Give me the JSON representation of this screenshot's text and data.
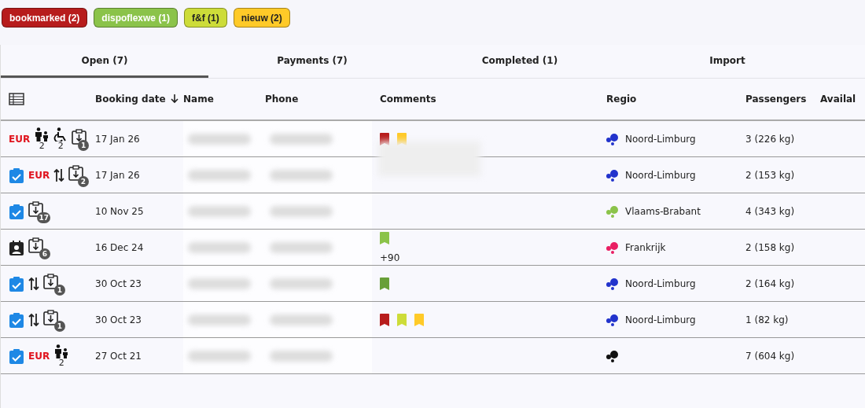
{
  "filters": [
    {
      "label": "bookmarked (2)",
      "color": "#b71c1c"
    },
    {
      "label": "dispoflexwe (1)",
      "color": "#8bc34a"
    },
    {
      "label": "f&f (1)",
      "color": "#cddc39"
    },
    {
      "label": "nieuw (2)",
      "color": "#ffca28"
    }
  ],
  "tabs": [
    {
      "label": "Open (7)",
      "selected": true
    },
    {
      "label": "Payments (7)",
      "selected": false
    },
    {
      "label": "Completed (1)",
      "selected": false
    },
    {
      "label": "Import",
      "selected": false
    }
  ],
  "table": {
    "columns": [
      {
        "label": "Booking date",
        "sorted_descending": true
      },
      {
        "label": "Name"
      },
      {
        "label": "Phone"
      },
      {
        "label": "Comments"
      },
      {
        "label": "Regio"
      },
      {
        "label": "Passengers"
      },
      {
        "label": "Availal"
      }
    ],
    "rows": [
      {
        "flags": [
          {
            "kind": "eur",
            "text": "EUR"
          },
          {
            "kind": "family",
            "count": "2"
          },
          {
            "kind": "wheelchair",
            "count": "2"
          },
          {
            "kind": "clipboard",
            "count": "1"
          }
        ],
        "date": "17 Jan 26",
        "comments": [
          {
            "kind": "bookmark",
            "color": "#b71c1c"
          },
          {
            "kind": "bookmark",
            "color": "#ffca28"
          }
        ],
        "comment_blurred": true,
        "regio": {
          "name": "Noord-Limburg",
          "color": "#2233cc"
        },
        "passengers": "3 (226 kg)"
      },
      {
        "flags": [
          {
            "kind": "check"
          },
          {
            "kind": "eur",
            "text": "EUR"
          },
          {
            "kind": "arrows"
          },
          {
            "kind": "clipboard",
            "count": "2"
          }
        ],
        "date": "17 Jan 26",
        "comments": [],
        "regio": {
          "name": "Noord-Limburg",
          "color": "#2233cc"
        },
        "passengers": "2 (153 kg)"
      },
      {
        "flags": [
          {
            "kind": "check"
          },
          {
            "kind": "clipboard",
            "count": "17"
          }
        ],
        "date": "10 Nov 25",
        "comments": [],
        "regio": {
          "name": "Vlaams-Brabant",
          "color": "#8bc34a"
        },
        "passengers": "4 (343 kg)"
      },
      {
        "flags": [
          {
            "kind": "contact"
          },
          {
            "kind": "clipboard",
            "count": "6"
          }
        ],
        "date": "16 Dec 24",
        "comments": [
          {
            "kind": "bookmark",
            "color": "#8bc34a"
          },
          {
            "kind": "more",
            "text": "+90"
          }
        ],
        "regio": {
          "name": "Frankrijk",
          "color": "#e91e63"
        },
        "passengers": "2 (158 kg)"
      },
      {
        "flags": [
          {
            "kind": "check"
          },
          {
            "kind": "arrows"
          },
          {
            "kind": "clipboard",
            "count": "1"
          }
        ],
        "date": "30 Oct 23",
        "comments": [
          {
            "kind": "bookmark",
            "color": "#689f38"
          }
        ],
        "regio": {
          "name": "Noord-Limburg",
          "color": "#2233cc"
        },
        "passengers": "2 (164 kg)"
      },
      {
        "flags": [
          {
            "kind": "check"
          },
          {
            "kind": "arrows"
          },
          {
            "kind": "clipboard",
            "count": "1"
          }
        ],
        "date": "30 Oct 23",
        "comments": [
          {
            "kind": "bookmark",
            "color": "#b71c1c"
          },
          {
            "kind": "bookmark",
            "color": "#cddc39"
          },
          {
            "kind": "bookmark",
            "color": "#ffca28"
          }
        ],
        "regio": {
          "name": "Noord-Limburg",
          "color": "#2233cc"
        },
        "passengers": "1 (82 kg)"
      },
      {
        "flags": [
          {
            "kind": "check"
          },
          {
            "kind": "eur",
            "text": "EUR"
          },
          {
            "kind": "family",
            "count": "2"
          }
        ],
        "date": "27 Oct 21",
        "comments": [],
        "regio": {
          "color": "#111111"
        },
        "passengers": "7 (604 kg)"
      }
    ]
  }
}
